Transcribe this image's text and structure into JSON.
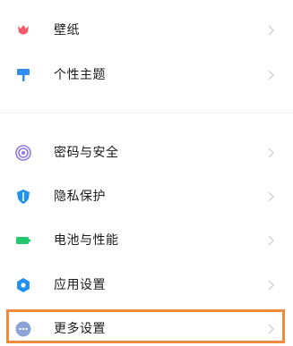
{
  "settings": {
    "items": [
      {
        "label": "壁纸",
        "icon": "tulip-icon",
        "color": "#f25a6c"
      },
      {
        "label": "个性主题",
        "icon": "paint-roller-icon",
        "color": "#2f8df5"
      },
      {
        "label": "密码与安全",
        "icon": "fingerprint-icon",
        "color": "#8e79e6"
      },
      {
        "label": "隐私保护",
        "icon": "shield-icon",
        "color": "#1f92f2"
      },
      {
        "label": "电池与性能",
        "icon": "battery-icon",
        "color": "#22c86a"
      },
      {
        "label": "应用设置",
        "icon": "gear-icon",
        "color": "#1f8ff2"
      },
      {
        "label": "更多设置",
        "icon": "more-dots-icon",
        "color": "#8aa3d9"
      }
    ]
  },
  "highlight_color": "#f08a3c"
}
